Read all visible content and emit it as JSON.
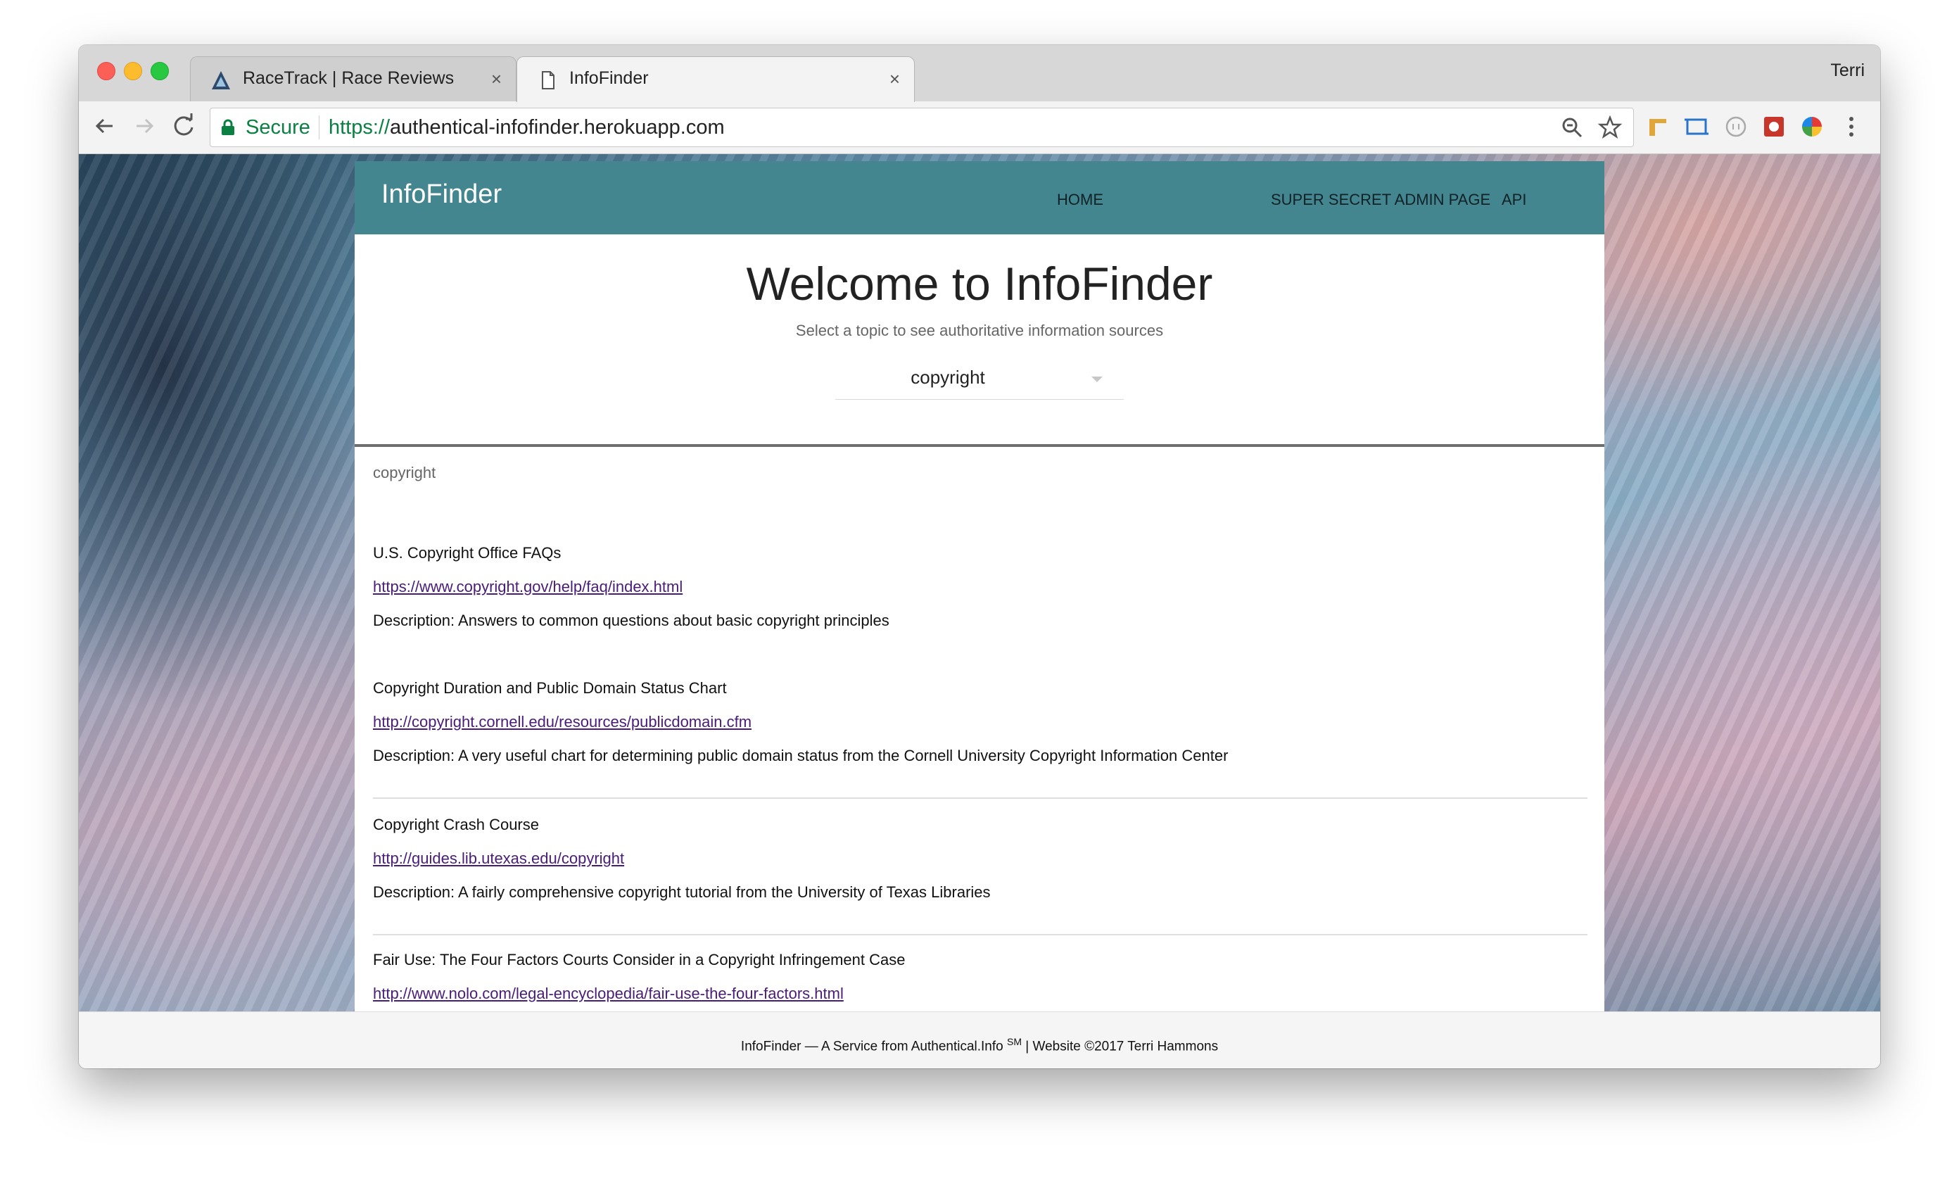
{
  "browser": {
    "tabs": [
      {
        "title": "RaceTrack | Race Reviews",
        "active": false
      },
      {
        "title": "InfoFinder",
        "active": true
      }
    ],
    "tab_close_glyph": "×",
    "profile_name": "Terri",
    "security_label": "Secure",
    "url_scheme": "https://",
    "url_host": "authentical-infofinder.herokuapp.com",
    "icons": [
      "back-icon",
      "forward-icon",
      "reload-icon",
      "lock-icon",
      "zoom-icon",
      "bookmark-star-icon",
      "menu-dots-icon"
    ],
    "colors": {
      "secure_green": "#0b8043",
      "tabstrip": "#d7d7d7"
    }
  },
  "site": {
    "brand": "InfoFinder",
    "nav": [
      {
        "label": "HOME"
      },
      {
        "label": "SUPER SECRET ADMIN PAGE"
      },
      {
        "label": "API"
      }
    ],
    "colors": {
      "header": "#43868f",
      "link": "#4a1c7a"
    }
  },
  "hero": {
    "title": "Welcome to InfoFinder",
    "subtitle": "Select a topic to see authoritative information sources",
    "topic_select_value": "copyright"
  },
  "results": {
    "topic": "copyright",
    "items": [
      {
        "title": "U.S. Copyright Office FAQs",
        "url": "https://www.copyright.gov/help/faq/index.html",
        "description": "Description: Answers to common questions about basic copyright principles"
      },
      {
        "title": "Copyright Duration and Public Domain Status Chart",
        "url": "http://copyright.cornell.edu/resources/publicdomain.cfm",
        "description": "Description: A very useful chart for determining public domain status from the Cornell University Copyright Information Center"
      },
      {
        "title": "Copyright Crash Course",
        "url": "http://guides.lib.utexas.edu/copyright",
        "description": "Description: A fairly comprehensive copyright tutorial from the University of Texas Libraries"
      },
      {
        "title": "Fair Use: The Four Factors Courts Consider in a Copyright Infringement Case",
        "url": "http://www.nolo.com/legal-encyclopedia/fair-use-the-four-factors.html",
        "description": ""
      }
    ]
  },
  "footer": {
    "text_main": "InfoFinder — A Service from Authentical.Info ",
    "service_mark": "SM",
    "text_end": " | Website ©2017 Terri Hammons"
  }
}
